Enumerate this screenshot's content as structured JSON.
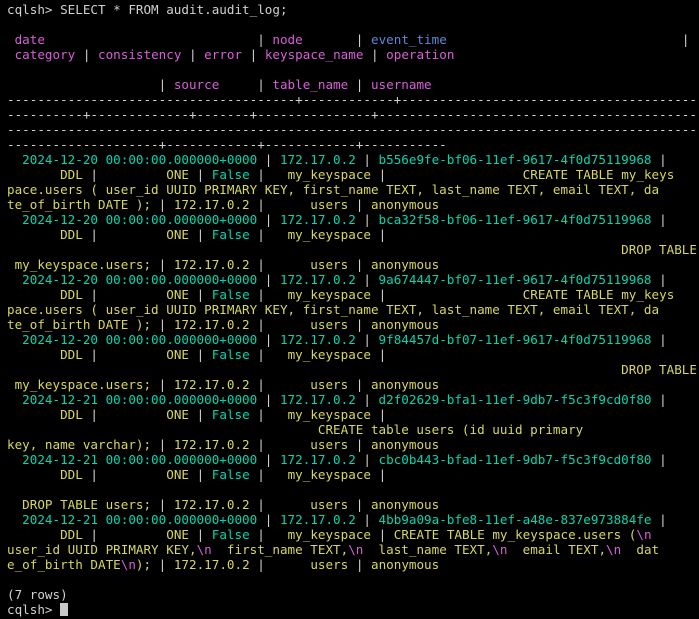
{
  "terminal": {
    "colors": {
      "background": "#000000",
      "text": "#d0d0d0",
      "header": "#d75fd7",
      "header_alt": "#5f87d7",
      "date": "#00d7af",
      "value": "#d7d75f",
      "escape": "#d75fd7"
    },
    "prompt": "cqlsh> ",
    "command": "SELECT * FROM audit.audit_log;",
    "lines": [
      [
        {
          "t": "cqlsh> SELECT * FROM audit.audit_log;",
          "c": "text"
        }
      ],
      [
        {
          "t": "",
          "c": "text"
        }
      ],
      [
        {
          "t": " date",
          "c": "header"
        },
        {
          "t": "                            | ",
          "c": "text"
        },
        {
          "t": "node",
          "c": "header"
        },
        {
          "t": "       | ",
          "c": "text"
        },
        {
          "t": "event_time",
          "c": "header_alt"
        },
        {
          "t": "                               |",
          "c": "text"
        }
      ],
      [
        {
          "t": " category",
          "c": "header"
        },
        {
          "t": " | ",
          "c": "text"
        },
        {
          "t": "consistency",
          "c": "header"
        },
        {
          "t": " | ",
          "c": "text"
        },
        {
          "t": "error",
          "c": "header"
        },
        {
          "t": " | ",
          "c": "text"
        },
        {
          "t": "keyspace_name",
          "c": "header"
        },
        {
          "t": " | ",
          "c": "text"
        },
        {
          "t": "operation",
          "c": "header"
        }
      ],
      [
        {
          "t": "",
          "c": "text"
        }
      ],
      [
        {
          "t": "                    | ",
          "c": "text"
        },
        {
          "t": "source",
          "c": "header"
        },
        {
          "t": "     | ",
          "c": "text"
        },
        {
          "t": "table_name",
          "c": "header"
        },
        {
          "t": " | ",
          "c": "text"
        },
        {
          "t": "username",
          "c": "header"
        }
      ],
      [
        {
          "t": "--------------------------------------+------------+-----------------------------------------+",
          "c": "text"
        }
      ],
      [
        {
          "t": "----------+-------------+-------+---------------+-------------------------------------------",
          "c": "text"
        }
      ],
      [
        {
          "t": "--------------------------------------------------------------------------------------------",
          "c": "text"
        }
      ],
      [
        {
          "t": "--------------------+------------+------------+-----------",
          "c": "text"
        }
      ],
      [
        {
          "t": "  2024-12-20 00:00:00.000000+0000",
          "c": "date"
        },
        {
          "t": " | ",
          "c": "text"
        },
        {
          "t": "172.17.0.2",
          "c": "date"
        },
        {
          "t": " | ",
          "c": "text"
        },
        {
          "t": "b556e9fe-bf06-11ef-9617-4f0d75119968",
          "c": "date"
        },
        {
          "t": " |",
          "c": "text"
        }
      ],
      [
        {
          "t": "       DDL",
          "c": "value"
        },
        {
          "t": " |",
          "c": "text"
        },
        {
          "t": "         ONE",
          "c": "value"
        },
        {
          "t": " | ",
          "c": "text"
        },
        {
          "t": "False",
          "c": "date"
        },
        {
          "t": " |",
          "c": "text"
        },
        {
          "t": "   my_keyspace",
          "c": "value"
        },
        {
          "t": " |",
          "c": "text"
        },
        {
          "t": "                  CREATE TABLE my_keys",
          "c": "value"
        }
      ],
      [
        {
          "t": "pace.users ( user_id UUID PRIMARY KEY, first_name TEXT, last_name TEXT, email TEXT, da",
          "c": "value"
        }
      ],
      [
        {
          "t": "te_of_birth DATE );",
          "c": "value"
        },
        {
          "t": " | ",
          "c": "text"
        },
        {
          "t": "172.17.0.2",
          "c": "value"
        },
        {
          "t": " |",
          "c": "text"
        },
        {
          "t": "      users",
          "c": "value"
        },
        {
          "t": " | ",
          "c": "text"
        },
        {
          "t": "anonymous",
          "c": "value"
        }
      ],
      [
        {
          "t": "  2024-12-20 00:00:00.000000+0000",
          "c": "date"
        },
        {
          "t": " | ",
          "c": "text"
        },
        {
          "t": "172.17.0.2",
          "c": "date"
        },
        {
          "t": " | ",
          "c": "text"
        },
        {
          "t": "bca32f58-bf06-11ef-9617-4f0d75119968",
          "c": "date"
        },
        {
          "t": " |",
          "c": "text"
        }
      ],
      [
        {
          "t": "       DDL",
          "c": "value"
        },
        {
          "t": " |",
          "c": "text"
        },
        {
          "t": "         ONE",
          "c": "value"
        },
        {
          "t": " | ",
          "c": "text"
        },
        {
          "t": "False",
          "c": "date"
        },
        {
          "t": " |",
          "c": "text"
        },
        {
          "t": "   my_keyspace",
          "c": "value"
        },
        {
          "t": " |",
          "c": "text"
        }
      ],
      [
        {
          "t": "                                                                                 DROP TABLE",
          "c": "value"
        }
      ],
      [
        {
          "t": " my_keyspace.users;",
          "c": "value"
        },
        {
          "t": " | ",
          "c": "text"
        },
        {
          "t": "172.17.0.2",
          "c": "value"
        },
        {
          "t": " |",
          "c": "text"
        },
        {
          "t": "      users",
          "c": "value"
        },
        {
          "t": " | ",
          "c": "text"
        },
        {
          "t": "anonymous",
          "c": "value"
        }
      ],
      [
        {
          "t": "  2024-12-20 00:00:00.000000+0000",
          "c": "date"
        },
        {
          "t": " | ",
          "c": "text"
        },
        {
          "t": "172.17.0.2",
          "c": "date"
        },
        {
          "t": " | ",
          "c": "text"
        },
        {
          "t": "9a674447-bf07-11ef-9617-4f0d75119968",
          "c": "date"
        },
        {
          "t": " |",
          "c": "text"
        }
      ],
      [
        {
          "t": "       DDL",
          "c": "value"
        },
        {
          "t": " |",
          "c": "text"
        },
        {
          "t": "         ONE",
          "c": "value"
        },
        {
          "t": " | ",
          "c": "text"
        },
        {
          "t": "False",
          "c": "date"
        },
        {
          "t": " |",
          "c": "text"
        },
        {
          "t": "   my_keyspace",
          "c": "value"
        },
        {
          "t": " |",
          "c": "text"
        },
        {
          "t": "                  CREATE TABLE my_keys",
          "c": "value"
        }
      ],
      [
        {
          "t": "pace.users ( user_id UUID PRIMARY KEY, first_name TEXT, last_name TEXT, email TEXT, da",
          "c": "value"
        }
      ],
      [
        {
          "t": "te_of_birth DATE );",
          "c": "value"
        },
        {
          "t": " | ",
          "c": "text"
        },
        {
          "t": "172.17.0.2",
          "c": "value"
        },
        {
          "t": " |",
          "c": "text"
        },
        {
          "t": "      users",
          "c": "value"
        },
        {
          "t": " | ",
          "c": "text"
        },
        {
          "t": "anonymous",
          "c": "value"
        }
      ],
      [
        {
          "t": "  2024-12-20 00:00:00.000000+0000",
          "c": "date"
        },
        {
          "t": " | ",
          "c": "text"
        },
        {
          "t": "172.17.0.2",
          "c": "date"
        },
        {
          "t": " | ",
          "c": "text"
        },
        {
          "t": "9f84457d-bf07-11ef-9617-4f0d75119968",
          "c": "date"
        },
        {
          "t": " |",
          "c": "text"
        }
      ],
      [
        {
          "t": "       DDL",
          "c": "value"
        },
        {
          "t": " |",
          "c": "text"
        },
        {
          "t": "         ONE",
          "c": "value"
        },
        {
          "t": " | ",
          "c": "text"
        },
        {
          "t": "False",
          "c": "date"
        },
        {
          "t": " |",
          "c": "text"
        },
        {
          "t": "   my_keyspace",
          "c": "value"
        },
        {
          "t": " |",
          "c": "text"
        }
      ],
      [
        {
          "t": "                                                                                 DROP TABLE",
          "c": "value"
        }
      ],
      [
        {
          "t": " my_keyspace.users;",
          "c": "value"
        },
        {
          "t": " | ",
          "c": "text"
        },
        {
          "t": "172.17.0.2",
          "c": "value"
        },
        {
          "t": " |",
          "c": "text"
        },
        {
          "t": "      users",
          "c": "value"
        },
        {
          "t": " | ",
          "c": "text"
        },
        {
          "t": "anonymous",
          "c": "value"
        }
      ],
      [
        {
          "t": "  2024-12-21 00:00:00.000000+0000",
          "c": "date"
        },
        {
          "t": " | ",
          "c": "text"
        },
        {
          "t": "172.17.0.2",
          "c": "date"
        },
        {
          "t": " | ",
          "c": "text"
        },
        {
          "t": "d2f02629-bfa1-11ef-9db7-f5c3f9cd0f80",
          "c": "date"
        },
        {
          "t": " |",
          "c": "text"
        }
      ],
      [
        {
          "t": "       DDL",
          "c": "value"
        },
        {
          "t": " |",
          "c": "text"
        },
        {
          "t": "         ONE",
          "c": "value"
        },
        {
          "t": " | ",
          "c": "text"
        },
        {
          "t": "False",
          "c": "date"
        },
        {
          "t": " |",
          "c": "text"
        },
        {
          "t": "   my_keyspace",
          "c": "value"
        },
        {
          "t": " |",
          "c": "text"
        }
      ],
      [
        {
          "t": "                                         CREATE table users (id uuid primary",
          "c": "value"
        }
      ],
      [
        {
          "t": "key, name varchar);",
          "c": "value"
        },
        {
          "t": " | ",
          "c": "text"
        },
        {
          "t": "172.17.0.2",
          "c": "value"
        },
        {
          "t": " |",
          "c": "text"
        },
        {
          "t": "      users",
          "c": "value"
        },
        {
          "t": " | ",
          "c": "text"
        },
        {
          "t": "anonymous",
          "c": "value"
        }
      ],
      [
        {
          "t": "  2024-12-21 00:00:00.000000+0000",
          "c": "date"
        },
        {
          "t": " | ",
          "c": "text"
        },
        {
          "t": "172.17.0.2",
          "c": "date"
        },
        {
          "t": " | ",
          "c": "text"
        },
        {
          "t": "cbc0b443-bfad-11ef-9db7-f5c3f9cd0f80",
          "c": "date"
        },
        {
          "t": " |",
          "c": "text"
        }
      ],
      [
        {
          "t": "       DDL",
          "c": "value"
        },
        {
          "t": " |",
          "c": "text"
        },
        {
          "t": "         ONE",
          "c": "value"
        },
        {
          "t": " | ",
          "c": "text"
        },
        {
          "t": "False",
          "c": "date"
        },
        {
          "t": " |",
          "c": "text"
        },
        {
          "t": "   my_keyspace",
          "c": "value"
        },
        {
          "t": " |",
          "c": "text"
        }
      ],
      [
        {
          "t": "",
          "c": "text"
        }
      ],
      [
        {
          "t": "  DROP TABLE users;",
          "c": "value"
        },
        {
          "t": " | ",
          "c": "text"
        },
        {
          "t": "172.17.0.2",
          "c": "value"
        },
        {
          "t": " |",
          "c": "text"
        },
        {
          "t": "      users",
          "c": "value"
        },
        {
          "t": " | ",
          "c": "text"
        },
        {
          "t": "anonymous",
          "c": "value"
        }
      ],
      [
        {
          "t": "  2024-12-21 00:00:00.000000+0000",
          "c": "date"
        },
        {
          "t": " | ",
          "c": "text"
        },
        {
          "t": "172.17.0.2",
          "c": "date"
        },
        {
          "t": " | ",
          "c": "text"
        },
        {
          "t": "4bb9a09a-bfe8-11ef-a48e-837e973884fe",
          "c": "date"
        },
        {
          "t": " |",
          "c": "text"
        }
      ],
      [
        {
          "t": "       DDL",
          "c": "value"
        },
        {
          "t": " |",
          "c": "text"
        },
        {
          "t": "         ONE",
          "c": "value"
        },
        {
          "t": " | ",
          "c": "text"
        },
        {
          "t": "False",
          "c": "date"
        },
        {
          "t": " |",
          "c": "text"
        },
        {
          "t": "   my_keyspace",
          "c": "value"
        },
        {
          "t": " | ",
          "c": "text"
        },
        {
          "t": "CREATE TABLE my_keyspace.users (",
          "c": "value"
        },
        {
          "t": "\\n",
          "c": "escape"
        }
      ],
      [
        {
          "t": "user_id UUID PRIMARY KEY,",
          "c": "value"
        },
        {
          "t": "\\n",
          "c": "escape"
        },
        {
          "t": "  first_name TEXT,",
          "c": "value"
        },
        {
          "t": "\\n",
          "c": "escape"
        },
        {
          "t": "  last_name TEXT,",
          "c": "value"
        },
        {
          "t": "\\n",
          "c": "escape"
        },
        {
          "t": "  email TEXT,",
          "c": "value"
        },
        {
          "t": "\\n",
          "c": "escape"
        },
        {
          "t": "  dat",
          "c": "value"
        }
      ],
      [
        {
          "t": "e_of_birth DATE",
          "c": "value"
        },
        {
          "t": "\\n",
          "c": "escape"
        },
        {
          "t": ");",
          "c": "value"
        },
        {
          "t": " | ",
          "c": "text"
        },
        {
          "t": "172.17.0.2",
          "c": "value"
        },
        {
          "t": " |",
          "c": "text"
        },
        {
          "t": "      users",
          "c": "value"
        },
        {
          "t": " | ",
          "c": "text"
        },
        {
          "t": "anonymous",
          "c": "value"
        }
      ],
      [
        {
          "t": "",
          "c": "text"
        }
      ],
      [
        {
          "t": "(7 rows)",
          "c": "text"
        }
      ]
    ]
  }
}
